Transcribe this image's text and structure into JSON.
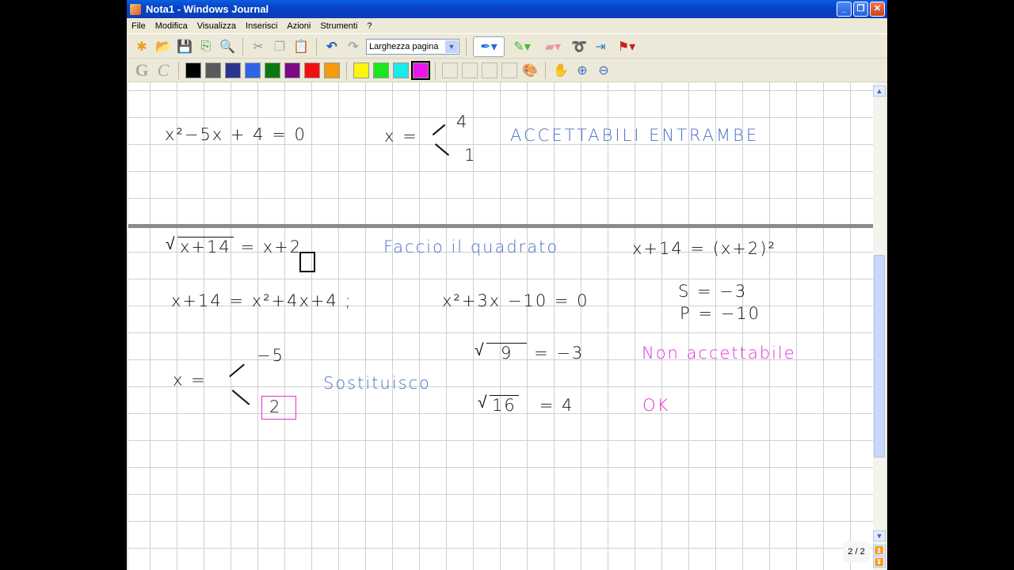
{
  "window": {
    "title": "Nota1 - Windows Journal"
  },
  "menu": [
    "File",
    "Modifica",
    "Visualizza",
    "Inserisci",
    "Azioni",
    "Strumenti",
    "?"
  ],
  "toolbar": {
    "zoom_select": "Larghezza pagina"
  },
  "palette": {
    "colors": [
      "#000000",
      "#5a5a5a",
      "#2a3590",
      "#2f64e8",
      "#0a7a10",
      "#7a0a86",
      "#f20f0f",
      "#f59a0a",
      "#fbf70a",
      "#1ae81a",
      "#19eaea",
      "#ea17ea"
    ],
    "selected": "#ea17ea"
  },
  "note": {
    "page1": {
      "eq": "x²−5x + 4 = 0",
      "x_eq": "x =",
      "root_a": "4",
      "root_b": "1",
      "comment": "ACCETTABILI  ENTRAMBE"
    },
    "page2": {
      "radicand": "x+14",
      "rhs": "= x+2",
      "comment1": "Faccio il quadrato",
      "squared": "x+14 = (x+2)²",
      "expanded": "x+14 = x²+4x+4 ;",
      "quadratic": "x²+3x −10 = 0",
      "sum": "S = −3",
      "product": "P = −10",
      "x_eq": "x =",
      "root_a": "−5",
      "root_b": "2",
      "comment2": "Sostituisco",
      "check1_rad": "9",
      "check1_rhs": "= −3",
      "verdict1": "Non accettabile",
      "check2_rad": "16",
      "check2_rhs": "=  4",
      "verdict2": "OK"
    }
  },
  "status": {
    "page": "2 / 2"
  }
}
